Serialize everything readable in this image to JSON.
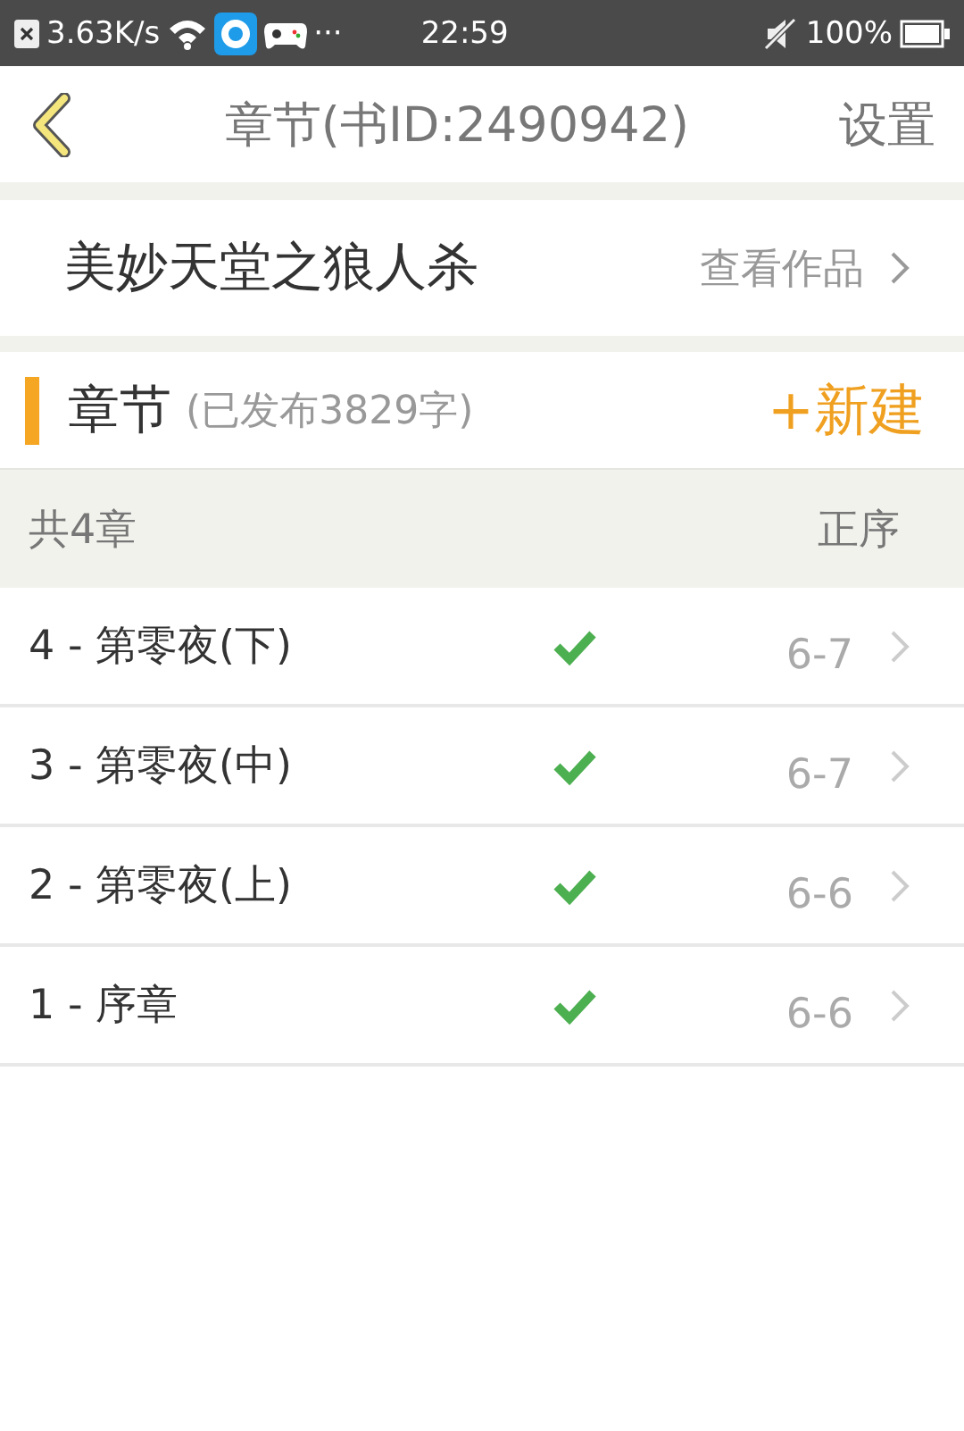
{
  "status_bar": {
    "speed": "3.63K/s",
    "more": "···",
    "time": "22:59",
    "battery": "100%"
  },
  "header": {
    "title": "章节(书ID:2490942)",
    "action": "设置"
  },
  "book": {
    "title": "美妙天堂之狼人杀",
    "link": "查看作品"
  },
  "section": {
    "title": "章节",
    "note": "(已发布3829字)",
    "action": "+新建"
  },
  "list_header": {
    "count": "共4章",
    "sort": "正序"
  },
  "chapters": [
    {
      "title": "4 - 第零夜(下)",
      "published": true,
      "date": "6-7"
    },
    {
      "title": "3 - 第零夜(中)",
      "published": true,
      "date": "6-7"
    },
    {
      "title": "2 - 第零夜(上)",
      "published": true,
      "date": "6-6"
    },
    {
      "title": "1 - 序章",
      "published": true,
      "date": "6-6"
    }
  ]
}
